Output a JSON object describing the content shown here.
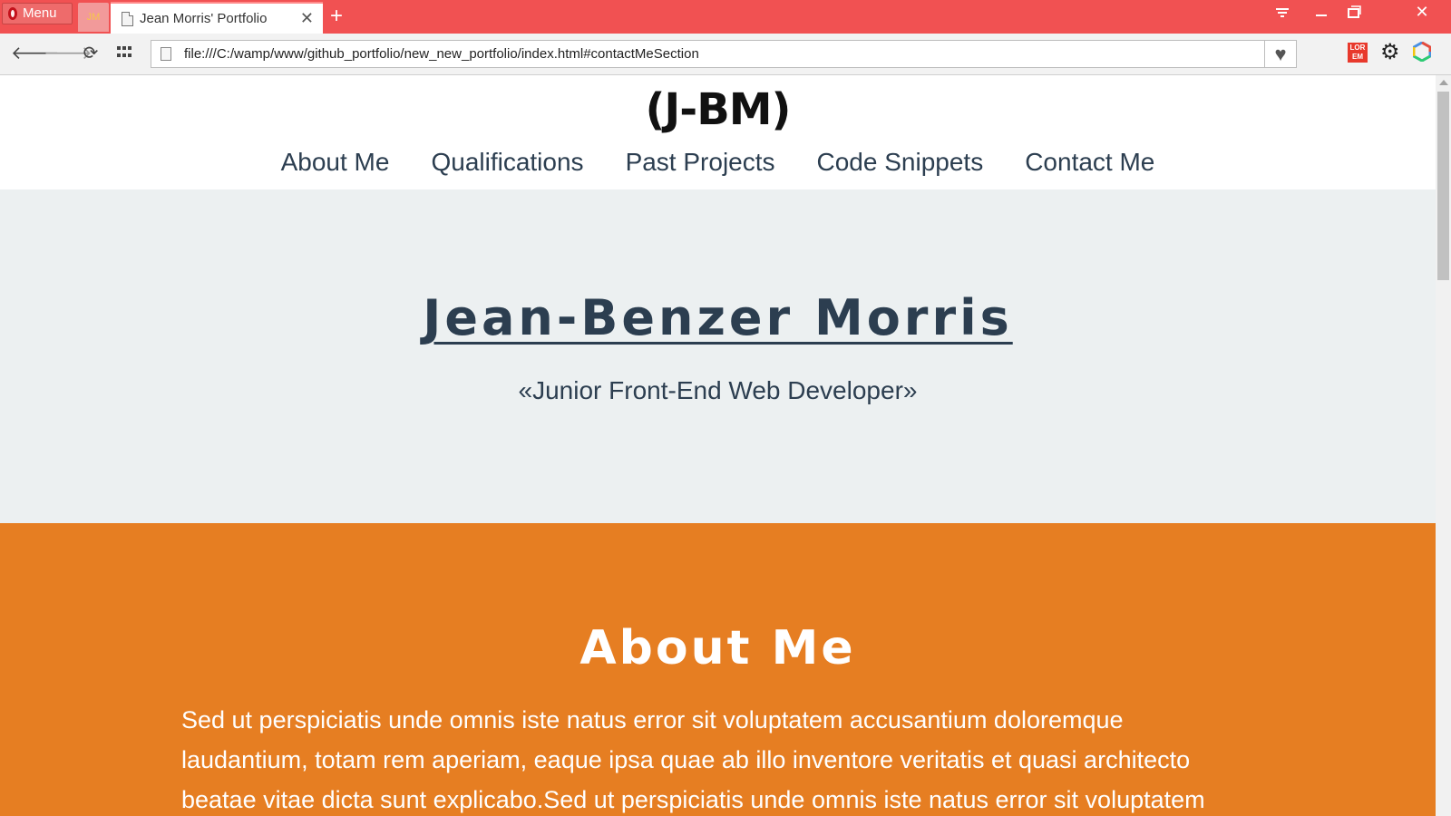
{
  "browser": {
    "menu_label": "Menu",
    "pinned_tab_label": "JM",
    "tab_title": "Jean Morris' Portfolio",
    "url": "file:///C:/wamp/www/github_portfolio/new_new_portfolio/index.html#contactMeSection",
    "toolbar_icons": [
      "back-icon",
      "forward-icon",
      "reload-icon",
      "speed-dial-icon",
      "heart-icon",
      "lorem-ipsum-icon",
      "gear-icon",
      "extension-hex-icon"
    ],
    "lorem_icon_text": "LOR EM",
    "tabbar_color": "#f15152"
  },
  "site": {
    "logo": "(J-BM)",
    "nav": [
      "About Me",
      "Qualifications",
      "Past Projects",
      "Code Snippets",
      "Contact Me"
    ],
    "hero": {
      "name": "Jean-Benzer Morris",
      "subtitle": "«Junior Front-End Web Developer»"
    },
    "about": {
      "heading": "About Me",
      "text": "Sed ut perspiciatis unde omnis iste natus error sit voluptatem accusantium doloremque laudantium, totam rem aperiam, eaque ipsa quae ab illo inventore veritatis et quasi architecto beatae vitae dicta sunt explicabo.Sed ut perspiciatis unde omnis iste natus error sit voluptatem"
    },
    "colors": {
      "primary_text": "#2c3e50",
      "hero_bg": "#ecf0f1",
      "about_bg": "#e67e22"
    }
  }
}
